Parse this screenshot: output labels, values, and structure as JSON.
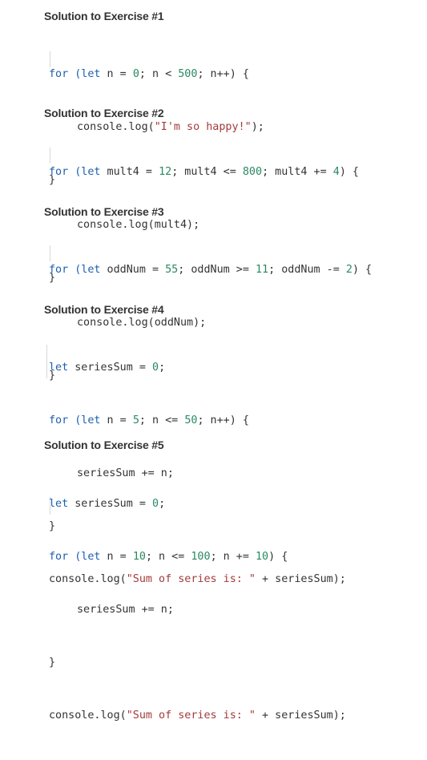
{
  "exercises": [
    {
      "title": "Solution to Exercise #1",
      "code": [
        [
          {
            "t": "kw",
            "v": "for"
          },
          {
            "t": "plain",
            "v": " "
          },
          {
            "t": "kw",
            "v": "(let"
          },
          {
            "t": "plain",
            "v": " n = "
          },
          {
            "t": "num",
            "v": "0"
          },
          {
            "t": "plain",
            "v": "; n < "
          },
          {
            "t": "num",
            "v": "500"
          },
          {
            "t": "plain",
            "v": "; n++) {"
          }
        ],
        [
          {
            "t": "plain",
            "v": "console.log("
          },
          {
            "t": "str",
            "v": "\"I'm so happy!\""
          },
          {
            "t": "plain",
            "v": ");"
          }
        ],
        [
          {
            "t": "plain",
            "v": "}"
          }
        ]
      ]
    },
    {
      "title": "Solution to Exercise #2",
      "code": [
        [
          {
            "t": "kw",
            "v": "for"
          },
          {
            "t": "plain",
            "v": " "
          },
          {
            "t": "kw",
            "v": "(let"
          },
          {
            "t": "plain",
            "v": " mult4 = "
          },
          {
            "t": "num",
            "v": "12"
          },
          {
            "t": "plain",
            "v": "; mult4 <= "
          },
          {
            "t": "num",
            "v": "800"
          },
          {
            "t": "plain",
            "v": "; mult4 += "
          },
          {
            "t": "num",
            "v": "4"
          },
          {
            "t": "plain",
            "v": ") {"
          }
        ],
        [
          {
            "t": "plain",
            "v": "console.log(mult4);"
          }
        ],
        [
          {
            "t": "plain",
            "v": "}"
          }
        ]
      ]
    },
    {
      "title": "Solution to Exercise #3",
      "code": [
        [
          {
            "t": "kw",
            "v": "for"
          },
          {
            "t": "plain",
            "v": " "
          },
          {
            "t": "kw",
            "v": "(let"
          },
          {
            "t": "plain",
            "v": " oddNum = "
          },
          {
            "t": "num",
            "v": "55"
          },
          {
            "t": "plain",
            "v": "; oddNum >= "
          },
          {
            "t": "num",
            "v": "11"
          },
          {
            "t": "plain",
            "v": "; oddNum -= "
          },
          {
            "t": "num",
            "v": "2"
          },
          {
            "t": "plain",
            "v": ") {"
          }
        ],
        [
          {
            "t": "plain",
            "v": "console.log(oddNum);"
          }
        ],
        [
          {
            "t": "plain",
            "v": "}"
          }
        ]
      ]
    },
    {
      "title": "Solution to Exercise #4",
      "code": [
        [
          {
            "t": "kw",
            "v": "let"
          },
          {
            "t": "plain",
            "v": " seriesSum = "
          },
          {
            "t": "num",
            "v": "0"
          },
          {
            "t": "plain",
            "v": ";"
          }
        ],
        [
          {
            "t": "kw",
            "v": "for"
          },
          {
            "t": "plain",
            "v": " "
          },
          {
            "t": "kw",
            "v": "(let"
          },
          {
            "t": "plain",
            "v": " n = "
          },
          {
            "t": "num",
            "v": "5"
          },
          {
            "t": "plain",
            "v": "; n <= "
          },
          {
            "t": "num",
            "v": "50"
          },
          {
            "t": "plain",
            "v": "; n++) {"
          }
        ],
        [
          {
            "t": "plain",
            "v": "seriesSum += n;"
          }
        ],
        [
          {
            "t": "plain",
            "v": "}"
          }
        ],
        [
          {
            "t": "plain",
            "v": "console.log("
          },
          {
            "t": "str",
            "v": "\"Sum of series is: \""
          },
          {
            "t": "plain",
            "v": " + seriesSum);"
          }
        ]
      ]
    },
    {
      "title": "Solution to Exercise #5",
      "code": [
        [
          {
            "t": "kw",
            "v": "let"
          },
          {
            "t": "plain",
            "v": " seriesSum = "
          },
          {
            "t": "num",
            "v": "0"
          },
          {
            "t": "plain",
            "v": ";"
          }
        ],
        [
          {
            "t": "kw",
            "v": "for"
          },
          {
            "t": "plain",
            "v": " "
          },
          {
            "t": "kw",
            "v": "(let"
          },
          {
            "t": "plain",
            "v": " n = "
          },
          {
            "t": "num",
            "v": "10"
          },
          {
            "t": "plain",
            "v": "; n <= "
          },
          {
            "t": "num",
            "v": "100"
          },
          {
            "t": "plain",
            "v": "; n += "
          },
          {
            "t": "num",
            "v": "10"
          },
          {
            "t": "plain",
            "v": ") {"
          }
        ],
        [
          {
            "t": "plain",
            "v": "seriesSum += n;"
          }
        ],
        [
          {
            "t": "plain",
            "v": "}"
          }
        ],
        [
          {
            "t": "plain",
            "v": "console.log("
          },
          {
            "t": "str",
            "v": "\"Sum of series is: \""
          },
          {
            "t": "plain",
            "v": " + seriesSum);"
          }
        ]
      ]
    }
  ]
}
